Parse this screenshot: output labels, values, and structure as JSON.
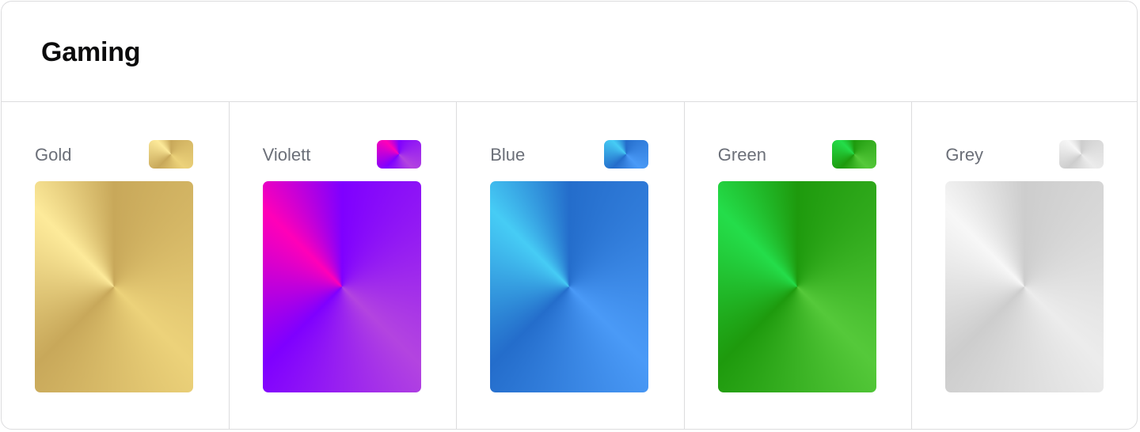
{
  "title": "Gaming",
  "swatches": [
    {
      "label": "Gold",
      "colors": {
        "a": "#fdea9a",
        "b": "#c8a85a",
        "c": "#ecd27a"
      }
    },
    {
      "label": "Violett",
      "colors": {
        "a": "#ff00b8",
        "b": "#7f00ff",
        "c": "#b344e0"
      }
    },
    {
      "label": "Blue",
      "colors": {
        "a": "#46ccf5",
        "b": "#246dcb",
        "c": "#4a9af7"
      }
    },
    {
      "label": "Green",
      "colors": {
        "a": "#24dd4a",
        "b": "#1e9a0d",
        "c": "#55c93a"
      }
    },
    {
      "label": "Grey",
      "colors": {
        "a": "#f7f7f7",
        "b": "#cdcdcd",
        "c": "#ececec"
      }
    }
  ]
}
